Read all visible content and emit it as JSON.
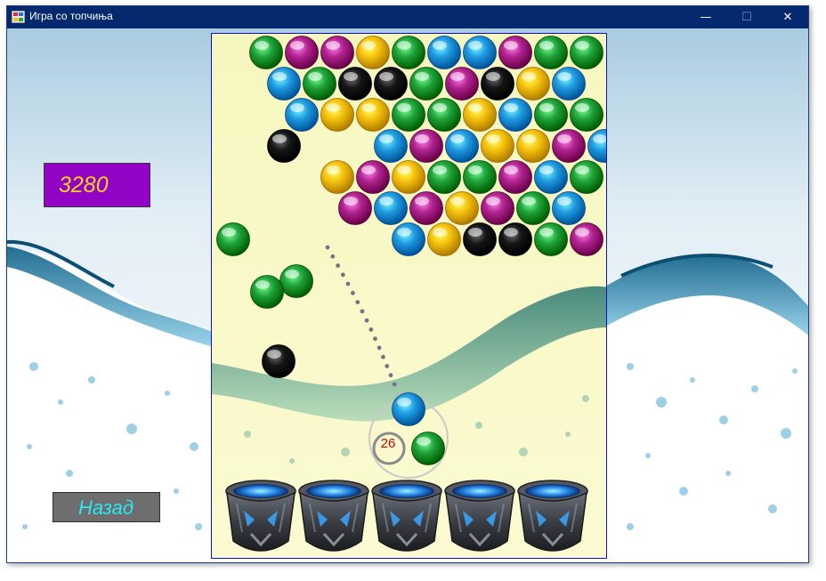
{
  "window": {
    "title": "Игра со топчиња",
    "minimize_glyph": "—",
    "maximize_glyph": "☐",
    "close_glyph": "✕"
  },
  "score": {
    "value": "3280",
    "background": "#9203c6",
    "color": "#ffd21f"
  },
  "back_button": {
    "label": "Назад",
    "color": "#28e8f2"
  },
  "game": {
    "shots_left": "26",
    "counter_color": "#d80000",
    "current_ball": "blue",
    "next_ball": "green",
    "colors": {
      "green": "#1fa33a",
      "purple": "#b0238f",
      "yellow": "#f6c20d",
      "blue": "#1f9ae0",
      "black": "#151515"
    },
    "grid_rows": [
      [
        "green",
        "purple",
        "purple",
        "yellow",
        "green",
        "blue",
        "blue",
        "purple",
        "green",
        "green"
      ],
      [
        "blue",
        "green",
        "black",
        "black",
        "green",
        "purple",
        "black",
        "yellow",
        "blue"
      ],
      [
        "blue",
        "yellow",
        "yellow",
        "green",
        "green",
        "yellow",
        "blue",
        "green",
        "green"
      ],
      [
        "black",
        "",
        "",
        "blue",
        "purple",
        "blue",
        "yellow",
        "yellow",
        "purple",
        "blue"
      ],
      [
        "yellow",
        "purple",
        "yellow",
        "green",
        "green",
        "purple",
        "blue",
        "green"
      ],
      [
        "purple",
        "blue",
        "purple",
        "yellow",
        "purple",
        "green",
        "blue"
      ],
      [
        "blue",
        "yellow",
        "black",
        "black",
        "green",
        "purple"
      ]
    ],
    "falling_balls": [
      "green",
      "green",
      "green",
      "black"
    ],
    "pots": [
      "pot-1",
      "pot-2",
      "pot-3",
      "pot-4",
      "pot-5"
    ]
  }
}
